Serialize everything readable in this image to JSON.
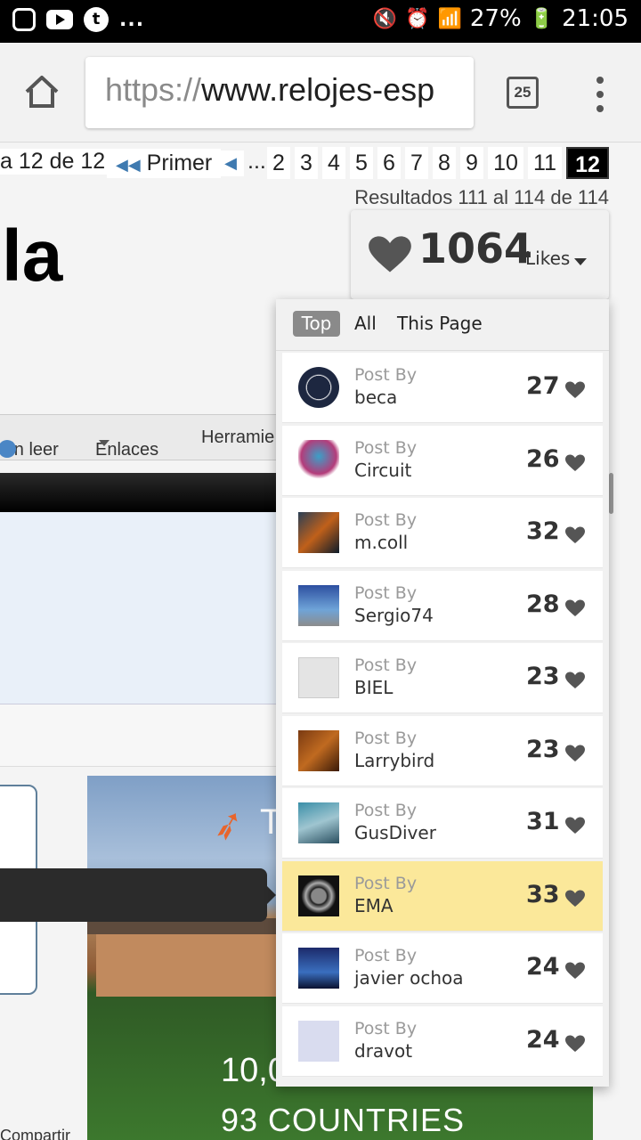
{
  "status_bar": {
    "dots": "...",
    "battery": "27%",
    "time": "21:05"
  },
  "browser": {
    "url_scheme": "https://",
    "url_host": "www.relojes-esp",
    "tab_count": "25"
  },
  "page": {
    "pagination": {
      "of_label": "a 12 de 12",
      "first_label": "Primer",
      "ellipsis": "...",
      "pages": [
        "2",
        "3",
        "4",
        "5",
        "6",
        "7",
        "8",
        "9",
        "10",
        "11",
        "12"
      ],
      "current": "12"
    },
    "results": "Resultados 111 al 114 de 114",
    "heading": "la",
    "nav": {
      "unread": "Sin leer",
      "links": "Enlaces",
      "tools": "Herramie"
    },
    "ad": {
      "line1": "10,0",
      "line2": "93 COUNTRIES",
      "logo_letter": "T"
    },
    "share": "Compartir"
  },
  "likes": {
    "count": "1064",
    "label": "Likes",
    "tabs": [
      "Top",
      "All",
      "This Page"
    ],
    "active_tab": "Top",
    "rows": [
      {
        "post_by": "Post By",
        "user": "beca",
        "count": "27"
      },
      {
        "post_by": "Post By",
        "user": "Circuit",
        "count": "26"
      },
      {
        "post_by": "Post By",
        "user": "m.coll",
        "count": "32"
      },
      {
        "post_by": "Post By",
        "user": "Sergio74",
        "count": "28"
      },
      {
        "post_by": "Post By",
        "user": "BIEL",
        "count": "23"
      },
      {
        "post_by": "Post By",
        "user": "Larrybird",
        "count": "23"
      },
      {
        "post_by": "Post By",
        "user": "GusDiver",
        "count": "31"
      },
      {
        "post_by": "Post By",
        "user": "EMA",
        "count": "33",
        "highlighted": true
      },
      {
        "post_by": "Post By",
        "user": "javier ochoa",
        "count": "24"
      },
      {
        "post_by": "Post By",
        "user": "dravot",
        "count": "24"
      }
    ]
  },
  "colors": {
    "highlight": "#fbe89a",
    "heart": "#555555",
    "current_page": "#000000"
  }
}
